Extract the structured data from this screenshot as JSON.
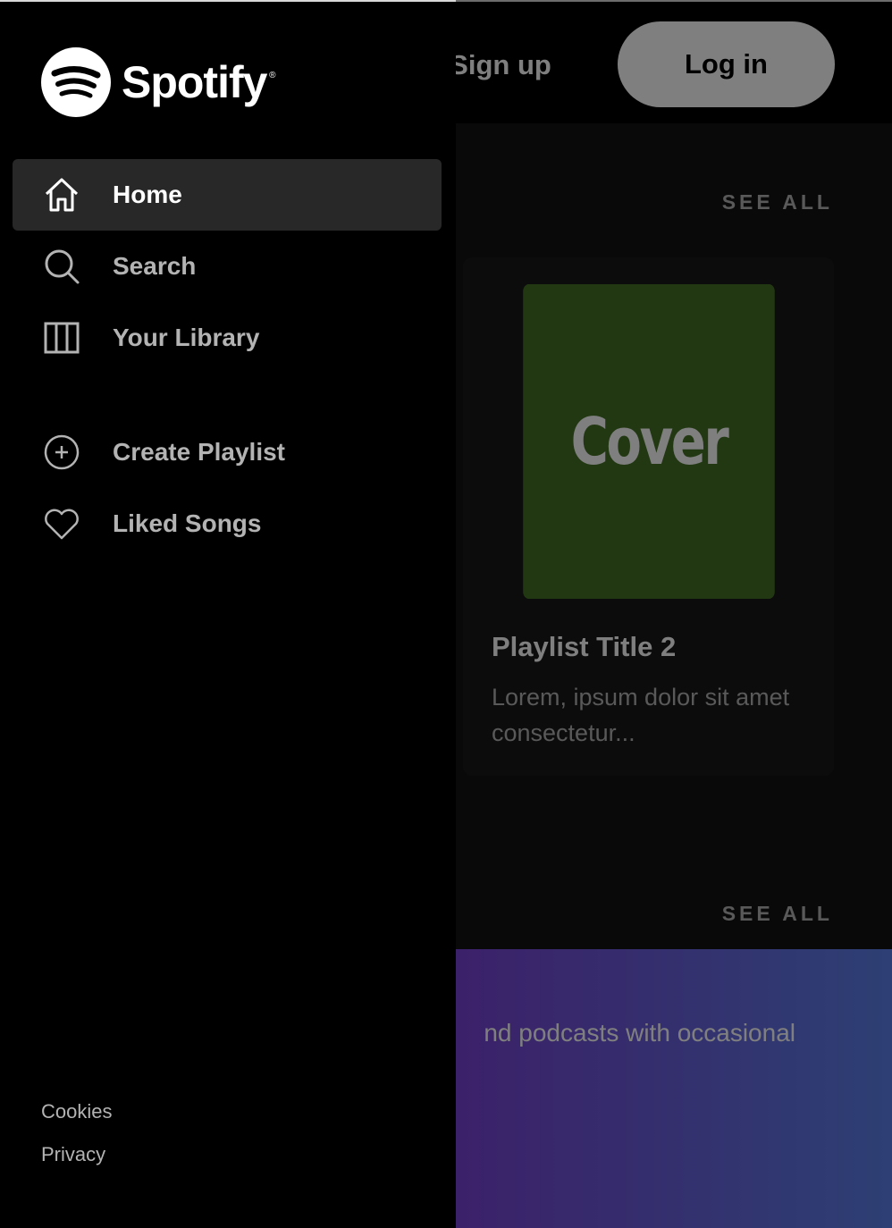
{
  "header": {
    "signup_label": "Sign up",
    "login_label": "Log in"
  },
  "sections": [
    {
      "see_all_label": "SEE ALL"
    },
    {
      "see_all_label": "SEE ALL"
    }
  ],
  "playlist_card": {
    "cover_text": "Cover",
    "title": "Playlist Title 2",
    "description": "Lorem, ipsum dolor sit amet consectetur..."
  },
  "banner": {
    "text": "nd podcasts with occasional"
  },
  "sidebar": {
    "logo_text": "Spotify",
    "logo_reg": "®",
    "nav_items": [
      {
        "label": "Home",
        "icon": "home-icon",
        "active": true
      },
      {
        "label": "Search",
        "icon": "search-icon",
        "active": false
      },
      {
        "label": "Your Library",
        "icon": "library-icon",
        "active": false
      }
    ],
    "actions": [
      {
        "label": "Create Playlist",
        "icon": "plus-circle-icon"
      },
      {
        "label": "Liked Songs",
        "icon": "heart-icon"
      }
    ],
    "footer_links": [
      "Cookies",
      "Privacy"
    ]
  },
  "colors": {
    "drawer_bg": "#000000",
    "active_item_bg": "#282828",
    "card_bg": "#181818",
    "cover_bg": "#447025",
    "banner_gradient_start": "#8c2fb8",
    "banner_gradient_end": "#5a7fe8"
  }
}
